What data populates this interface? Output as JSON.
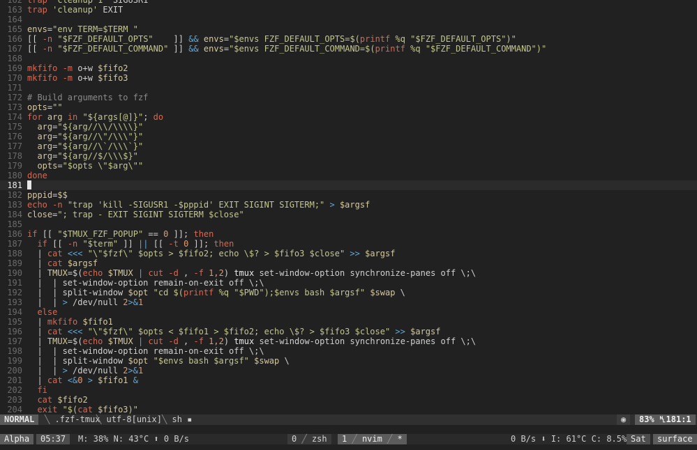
{
  "editor": {
    "current_line": 181,
    "lines": [
      {
        "n": "162",
        "t": [
          [
            "kw",
            "trap "
          ],
          [
            "str",
            "'cleanup 1' "
          ],
          [
            "plain",
            "SIGUSR1"
          ]
        ]
      },
      {
        "n": "163",
        "t": [
          [
            "kw",
            "trap "
          ],
          [
            "str",
            "'cleanup' "
          ],
          [
            "plain",
            "EXIT"
          ]
        ]
      },
      {
        "n": "164",
        "t": []
      },
      {
        "n": "165",
        "t": [
          [
            "var",
            "envs"
          ],
          [
            "plain",
            "="
          ],
          [
            "str",
            "\"env TERM=$TERM \""
          ]
        ]
      },
      {
        "n": "166",
        "t": [
          [
            "plain",
            "[[ "
          ],
          [
            "kw",
            "-n "
          ],
          [
            "str",
            "\"$FZF_DEFAULT_OPTS\"    "
          ],
          [
            "plain",
            "]] "
          ],
          [
            "op",
            "&& "
          ],
          [
            "var",
            "envs"
          ],
          [
            "plain",
            "="
          ],
          [
            "str",
            "\"$envs FZF_DEFAULT_OPTS=$("
          ],
          [
            "kw",
            "printf "
          ],
          [
            "str",
            "%q \"$FZF_DEFAULT_OPTS\")\""
          ]
        ]
      },
      {
        "n": "167",
        "t": [
          [
            "plain",
            "[[ "
          ],
          [
            "kw",
            "-n "
          ],
          [
            "str",
            "\"$FZF_DEFAULT_COMMAND\" "
          ],
          [
            "plain",
            "]] "
          ],
          [
            "op",
            "&& "
          ],
          [
            "var",
            "envs"
          ],
          [
            "plain",
            "="
          ],
          [
            "str",
            "\"$envs FZF_DEFAULT_COMMAND=$("
          ],
          [
            "kw",
            "printf "
          ],
          [
            "str",
            "%q \"$FZF_DEFAULT_COMMAND\")\""
          ]
        ]
      },
      {
        "n": "168",
        "t": []
      },
      {
        "n": "169",
        "t": [
          [
            "kw",
            "mkfifo "
          ],
          [
            "kw",
            "-m "
          ],
          [
            "plain",
            "o+w "
          ],
          [
            "var",
            "$fifo2"
          ]
        ]
      },
      {
        "n": "170",
        "t": [
          [
            "kw",
            "mkfifo "
          ],
          [
            "kw",
            "-m "
          ],
          [
            "plain",
            "o+w "
          ],
          [
            "var",
            "$fifo3"
          ]
        ]
      },
      {
        "n": "171",
        "t": []
      },
      {
        "n": "172",
        "t": [
          [
            "cmt",
            "# Build arguments to fzf"
          ]
        ]
      },
      {
        "n": "173",
        "t": [
          [
            "var",
            "opts"
          ],
          [
            "plain",
            "="
          ],
          [
            "str",
            "\"\""
          ]
        ]
      },
      {
        "n": "174",
        "t": [
          [
            "kw",
            "for "
          ],
          [
            "var",
            "arg "
          ],
          [
            "kw",
            "in "
          ],
          [
            "str",
            "\"${args[@]}\""
          ],
          [
            "plain",
            "; "
          ],
          [
            "kw",
            "do"
          ]
        ]
      },
      {
        "n": "175",
        "t": [
          [
            "plain",
            "  "
          ],
          [
            "var",
            "arg"
          ],
          [
            "plain",
            "="
          ],
          [
            "str",
            "\"${arg//\\\\/\\\\\\\\}\""
          ]
        ]
      },
      {
        "n": "176",
        "t": [
          [
            "plain",
            "  "
          ],
          [
            "var",
            "arg"
          ],
          [
            "plain",
            "="
          ],
          [
            "str",
            "\"${arg//\\\"/\\\\\\\"}\""
          ]
        ]
      },
      {
        "n": "177",
        "t": [
          [
            "plain",
            "  "
          ],
          [
            "var",
            "arg"
          ],
          [
            "plain",
            "="
          ],
          [
            "str",
            "\"${arg//\\`/\\\\\\`}\""
          ]
        ]
      },
      {
        "n": "178",
        "t": [
          [
            "plain",
            "  "
          ],
          [
            "var",
            "arg"
          ],
          [
            "plain",
            "="
          ],
          [
            "str",
            "\"${arg//$/\\\\\\$}\""
          ]
        ]
      },
      {
        "n": "179",
        "t": [
          [
            "plain",
            "  "
          ],
          [
            "var",
            "opts"
          ],
          [
            "plain",
            "="
          ],
          [
            "str",
            "\"$opts \\\"$arg\\\"\""
          ]
        ]
      },
      {
        "n": "180",
        "t": [
          [
            "kw",
            "done"
          ]
        ]
      },
      {
        "n": "181",
        "t": [],
        "cursor": true
      },
      {
        "n": "182",
        "t": [
          [
            "var",
            "pppid"
          ],
          [
            "plain",
            "="
          ],
          [
            "var",
            "$$"
          ]
        ]
      },
      {
        "n": "183",
        "t": [
          [
            "kw",
            "echo "
          ],
          [
            "kw",
            "-n "
          ],
          [
            "str",
            "\"trap 'kill -SIGUSR1 -$pppid' EXIT SIGINT SIGTERM;\" "
          ],
          [
            "op",
            "> "
          ],
          [
            "var",
            "$argsf"
          ]
        ]
      },
      {
        "n": "184",
        "t": [
          [
            "var",
            "close"
          ],
          [
            "plain",
            "="
          ],
          [
            "str",
            "\"; trap - EXIT SIGINT SIGTERM $close\""
          ]
        ]
      },
      {
        "n": "185",
        "t": []
      },
      {
        "n": "186",
        "t": [
          [
            "kw",
            "if "
          ],
          [
            "plain",
            "[[ "
          ],
          [
            "str",
            "\"$TMUX_FZF_POPUP\" "
          ],
          [
            "plain",
            "== "
          ],
          [
            "num",
            "0 "
          ],
          [
            "plain",
            "]]; "
          ],
          [
            "kw",
            "then"
          ]
        ]
      },
      {
        "n": "187",
        "t": [
          [
            "plain",
            "  "
          ],
          [
            "kw",
            "if "
          ],
          [
            "plain",
            "[[ "
          ],
          [
            "kw",
            "-n "
          ],
          [
            "str",
            "\"$term\" "
          ],
          [
            "plain",
            "]] "
          ],
          [
            "op",
            "|| "
          ],
          [
            "plain",
            "[[ "
          ],
          [
            "kw",
            "-t "
          ],
          [
            "num",
            "0 "
          ],
          [
            "plain",
            "]]; "
          ],
          [
            "kw",
            "then"
          ]
        ]
      },
      {
        "n": "188",
        "t": [
          [
            "guide",
            "  | "
          ],
          [
            "kw",
            "cat "
          ],
          [
            "op",
            "<<< "
          ],
          [
            "str",
            "\"\\\"$fzf\\\" $opts > $fifo2; echo \\$? > $fifo3 $close\" "
          ],
          [
            "op",
            ">> "
          ],
          [
            "var",
            "$argsf"
          ]
        ]
      },
      {
        "n": "189",
        "t": [
          [
            "guide",
            "  | "
          ],
          [
            "kw",
            "cat "
          ],
          [
            "var",
            "$argsf"
          ]
        ]
      },
      {
        "n": "190",
        "t": [
          [
            "guide",
            "  | "
          ],
          [
            "var",
            "TMUX"
          ],
          [
            "plain",
            "=$("
          ],
          [
            "kw",
            "echo "
          ],
          [
            "var",
            "$TMUX "
          ],
          [
            "op",
            "| "
          ],
          [
            "kw",
            "cut "
          ],
          [
            "kw",
            "-d "
          ],
          [
            "plain",
            ", "
          ],
          [
            "kw",
            "-f "
          ],
          [
            "num",
            "1,2"
          ],
          [
            "plain",
            ") "
          ],
          [
            "fn",
            "tmux "
          ],
          [
            "plain",
            "set-window-option synchronize-panes off \\;\\"
          ]
        ]
      },
      {
        "n": "191",
        "t": [
          [
            "guide",
            "  |  | "
          ],
          [
            "plain",
            "set-window-option remain-on-exit off \\;\\"
          ]
        ]
      },
      {
        "n": "192",
        "t": [
          [
            "guide",
            "  |  | "
          ],
          [
            "plain",
            "split-window "
          ],
          [
            "var",
            "$opt "
          ],
          [
            "str",
            "\"cd $("
          ],
          [
            "kw",
            "printf "
          ],
          [
            "str",
            "%q \"$PWD\");$envs bash $argsf\" "
          ],
          [
            "var",
            "$swap "
          ],
          [
            "plain",
            "\\"
          ]
        ]
      },
      {
        "n": "193",
        "t": [
          [
            "guide",
            "  |  | "
          ],
          [
            "op",
            "> "
          ],
          [
            "plain",
            "/dev/null "
          ],
          [
            "num",
            "2"
          ],
          [
            "op",
            ">&"
          ],
          [
            "num",
            "1"
          ]
        ]
      },
      {
        "n": "194",
        "t": [
          [
            "plain",
            "  "
          ],
          [
            "kw",
            "else"
          ]
        ]
      },
      {
        "n": "195",
        "t": [
          [
            "guide",
            "  | "
          ],
          [
            "kw",
            "mkfifo "
          ],
          [
            "var",
            "$fifo1"
          ]
        ]
      },
      {
        "n": "196",
        "t": [
          [
            "guide",
            "  | "
          ],
          [
            "kw",
            "cat "
          ],
          [
            "op",
            "<<< "
          ],
          [
            "str",
            "\"\\\"$fzf\\\" $opts < $fifo1 > $fifo2; echo \\$? > $fifo3 $close\" "
          ],
          [
            "op",
            ">> "
          ],
          [
            "var",
            "$argsf"
          ]
        ]
      },
      {
        "n": "197",
        "t": [
          [
            "guide",
            "  | "
          ],
          [
            "var",
            "TMUX"
          ],
          [
            "plain",
            "=$("
          ],
          [
            "kw",
            "echo "
          ],
          [
            "var",
            "$TMUX "
          ],
          [
            "op",
            "| "
          ],
          [
            "kw",
            "cut "
          ],
          [
            "kw",
            "-d "
          ],
          [
            "plain",
            ", "
          ],
          [
            "kw",
            "-f "
          ],
          [
            "num",
            "1,2"
          ],
          [
            "plain",
            ") "
          ],
          [
            "fn",
            "tmux "
          ],
          [
            "plain",
            "set-window-option synchronize-panes off \\;\\"
          ]
        ]
      },
      {
        "n": "198",
        "t": [
          [
            "guide",
            "  |  | "
          ],
          [
            "plain",
            "set-window-option remain-on-exit off \\;\\"
          ]
        ]
      },
      {
        "n": "199",
        "t": [
          [
            "guide",
            "  |  | "
          ],
          [
            "plain",
            "split-window "
          ],
          [
            "var",
            "$opt "
          ],
          [
            "str",
            "\"$envs bash $argsf\" "
          ],
          [
            "var",
            "$swap "
          ],
          [
            "plain",
            "\\"
          ]
        ]
      },
      {
        "n": "200",
        "t": [
          [
            "guide",
            "  |  | "
          ],
          [
            "op",
            "> "
          ],
          [
            "plain",
            "/dev/null "
          ],
          [
            "num",
            "2"
          ],
          [
            "op",
            ">&"
          ],
          [
            "num",
            "1"
          ]
        ]
      },
      {
        "n": "201",
        "t": [
          [
            "guide",
            "  | "
          ],
          [
            "kw",
            "cat "
          ],
          [
            "op",
            "<&"
          ],
          [
            "num",
            "0 "
          ],
          [
            "op",
            "> "
          ],
          [
            "var",
            "$fifo1 "
          ],
          [
            "op",
            "&"
          ]
        ]
      },
      {
        "n": "202",
        "t": [
          [
            "plain",
            "  "
          ],
          [
            "kw",
            "fi"
          ]
        ]
      },
      {
        "n": "203",
        "t": [
          [
            "plain",
            "  "
          ],
          [
            "kw",
            "cat "
          ],
          [
            "var",
            "$fifo2"
          ]
        ]
      },
      {
        "n": "204",
        "t": [
          [
            "plain",
            "  "
          ],
          [
            "kw",
            "exit "
          ],
          [
            "str",
            "\"$("
          ],
          [
            "kw",
            "cat "
          ],
          [
            "var",
            "$fifo3"
          ],
          [
            "str",
            ")\""
          ]
        ]
      }
    ]
  },
  "statusline": {
    "mode": "NORMAL",
    "file": ".fzf-tmux",
    "encoding": "utf-8[unix]",
    "filetype": "sh",
    "filetype_icon": "file-icon",
    "percent": "83%",
    "position": "181:1",
    "position_icon": "line-number-icon",
    "git_icon": "git-icon"
  },
  "tmux": {
    "session": "Alpha",
    "time": "05:37",
    "memory": "M: 38%",
    "net_temp": "N: 43°C",
    "upload_icon": "upload-icon",
    "upload": "0 B/s",
    "win0_index": "0",
    "win0_name": "zsh",
    "win1_index": "1",
    "win1_name": "nvim",
    "win1_flag": "*",
    "download": "0 B/s",
    "download_icon": "download-icon",
    "cpu_temp": "I: 61°C",
    "cpu": "C: 8.5%",
    "day": "Sat",
    "host": "surface"
  },
  "colors": {
    "background": "#212121",
    "keyword": "#e0654c",
    "string": "#c4c78c",
    "variable": "#d7c99a",
    "comment": "#8a8a8a",
    "operator": "#5fa7d9",
    "number": "#e89a6a"
  }
}
